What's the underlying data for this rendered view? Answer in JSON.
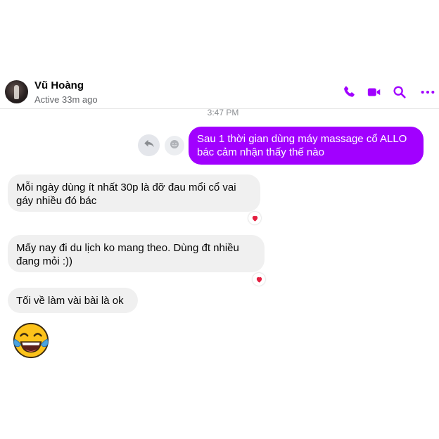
{
  "header": {
    "name": "Vũ Hoàng",
    "status": "Active 33m ago",
    "accent_color": "#a100ff",
    "icons": [
      "phone-icon",
      "video-icon",
      "search-icon",
      "more-icon"
    ]
  },
  "conversation": {
    "timestamp": "3:47 PM",
    "outgoing": {
      "lines": [
        "Sau 1 thời gian dùng máy massage cổ ALLO",
        "bác cảm nhận thấy thế nào"
      ],
      "bubble_color": "#a100ff"
    },
    "incoming": [
      {
        "lines": [
          "Mỗi ngày dùng ít nhất 30p là đỡ đau mổi cổ vai",
          "gáy nhiều đó bác"
        ],
        "reaction": "heart-icon"
      },
      {
        "lines": [
          "Mấy nay đi du lịch ko mang theo. Dùng đt nhiều",
          "đang mỏi :))"
        ],
        "reaction": "heart-icon"
      },
      {
        "lines": [
          "Tối về làm vài bài là ok"
        ]
      }
    ],
    "emoji": "face-with-tears-of-joy-icon"
  }
}
